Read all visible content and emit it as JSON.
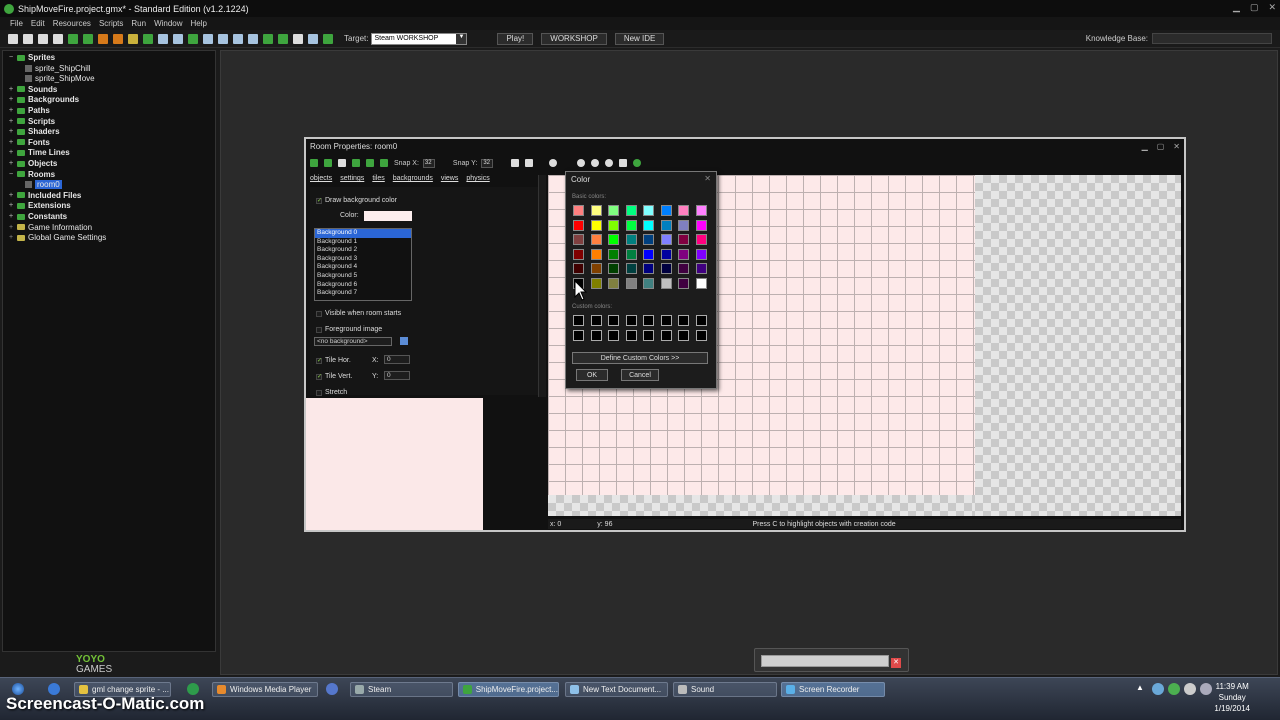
{
  "window": {
    "title": "ShipMoveFire.project.gmx* - Standard Edition (v1.2.1224)"
  },
  "menu": [
    "File",
    "Edit",
    "Resources",
    "Scripts",
    "Run",
    "Window",
    "Help"
  ],
  "toolbar": {
    "target_label": "Target:",
    "target_value": "Steam WORKSHOP",
    "buttons": [
      "Play!",
      "WORKSHOP",
      "New IDE"
    ],
    "knowledge_base_label": "Knowledge Base:"
  },
  "tree": [
    {
      "label": "Sprites",
      "level": 0,
      "bold": true,
      "expanded": true
    },
    {
      "label": "sprite_ShipChill",
      "level": 1
    },
    {
      "label": "sprite_ShipMove",
      "level": 1
    },
    {
      "label": "Sounds",
      "level": 0,
      "bold": true
    },
    {
      "label": "Backgrounds",
      "level": 0,
      "bold": true
    },
    {
      "label": "Paths",
      "level": 0,
      "bold": true
    },
    {
      "label": "Scripts",
      "level": 0,
      "bold": true
    },
    {
      "label": "Shaders",
      "level": 0,
      "bold": true
    },
    {
      "label": "Fonts",
      "level": 0,
      "bold": true
    },
    {
      "label": "Time Lines",
      "level": 0,
      "bold": true
    },
    {
      "label": "Objects",
      "level": 0,
      "bold": true
    },
    {
      "label": "Rooms",
      "level": 0,
      "bold": true,
      "expanded": true
    },
    {
      "label": "room0",
      "level": 1,
      "selected": true
    },
    {
      "label": "Included Files",
      "level": 0,
      "bold": true
    },
    {
      "label": "Extensions",
      "level": 0,
      "bold": true
    },
    {
      "label": "Constants",
      "level": 0,
      "bold": true
    },
    {
      "label": "Game Information",
      "level": 0
    },
    {
      "label": "Global Game Settings",
      "level": 0
    }
  ],
  "logo": {
    "line1": "YOYO",
    "line2": "GAMES"
  },
  "room": {
    "title": "Room Properties: room0",
    "snap_x_label": "Snap X:",
    "snap_x": "32",
    "snap_y_label": "Snap Y:",
    "snap_y": "32",
    "tabs": [
      "objects",
      "settings",
      "tiles",
      "backgrounds",
      "views",
      "physics"
    ],
    "draw_bg_color": "Draw background color",
    "color_label": "Color:",
    "backgrounds": [
      "Background 0",
      "Background 1",
      "Background 2",
      "Background 3",
      "Background 4",
      "Background 5",
      "Background 6",
      "Background 7"
    ],
    "visible_when_starts": "Visible when room starts",
    "foreground_image": "Foreground image",
    "no_background": "<no background>",
    "tile_hor": "Tile Hor.",
    "tile_vert": "Tile Vert.",
    "x_label": "X:",
    "x_value": "0",
    "y_label": "Y:",
    "y_value": "0",
    "stretch": "Stretch",
    "status_x": "x: 0",
    "status_y": "y: 96",
    "status_msg": "Press C to highlight objects with creation code"
  },
  "color_dialog": {
    "title": "Color",
    "basic_label": "Basic colors:",
    "custom_label": "Custom colors:",
    "basic_colors": [
      "#ff8080",
      "#ffff80",
      "#80ff80",
      "#00ff80",
      "#80ffff",
      "#0080ff",
      "#ff80c0",
      "#ff80ff",
      "#ff0000",
      "#ffff00",
      "#80ff00",
      "#00ff40",
      "#00ffff",
      "#0080c0",
      "#8080c0",
      "#ff00ff",
      "#804040",
      "#ff8040",
      "#00ff00",
      "#008080",
      "#004080",
      "#8080ff",
      "#800040",
      "#ff0080",
      "#800000",
      "#ff8000",
      "#008000",
      "#008040",
      "#0000ff",
      "#0000a0",
      "#800080",
      "#8000ff",
      "#400000",
      "#804000",
      "#004000",
      "#004040",
      "#000080",
      "#000040",
      "#400040",
      "#400080",
      "#000000",
      "#808000",
      "#808040",
      "#808080",
      "#408080",
      "#c0c0c0",
      "#400040",
      "#ffffff"
    ],
    "define_custom": "Define Custom Colors >>",
    "ok": "OK",
    "cancel": "Cancel"
  },
  "taskbar": {
    "items": [
      "gml change sprite - ...",
      "Windows Media Player",
      "Steam",
      "ShipMoveFire.project...",
      "New Text Document...",
      "Sound",
      "Screen Recorder"
    ],
    "time": "11:39 AM",
    "day": "Sunday",
    "date": "1/19/2014"
  },
  "watermark": "Screencast-O-Matic.com"
}
